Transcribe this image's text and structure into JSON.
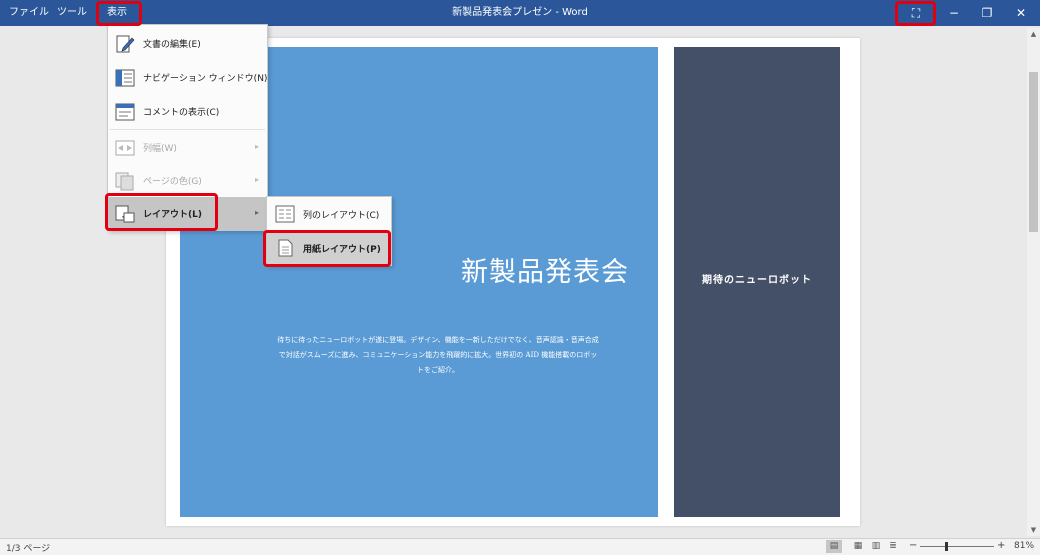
{
  "window": {
    "title": "新製品発表会プレゼン - Word",
    "menu": [
      "ファイル",
      "ツール",
      "表示"
    ],
    "controls": {
      "fullscreen": "⛶",
      "minimize": "−",
      "restore": "❐",
      "close": "✕"
    }
  },
  "view_menu": {
    "items": [
      {
        "label": "文書の編集(E)",
        "icon": "edit-document-icon",
        "enabled": true
      },
      {
        "label": "ナビゲーション ウィンドウ(N)",
        "icon": "navigation-pane-icon",
        "enabled": true
      },
      {
        "label": "コメントの表示(C)",
        "icon": "comment-icon",
        "enabled": true
      },
      {
        "label": "列幅(W)",
        "icon": "column-width-icon",
        "enabled": false,
        "submenu": true
      },
      {
        "label": "ページの色(G)",
        "icon": "page-color-icon",
        "enabled": false,
        "submenu": true
      },
      {
        "label": "レイアウト(L)",
        "icon": "layout-icon",
        "enabled": true,
        "submenu": true,
        "active": true
      }
    ]
  },
  "layout_submenu": {
    "items": [
      {
        "label": "列のレイアウト(C)",
        "icon": "column-layout-icon"
      },
      {
        "label": "用紙レイアウト(P)",
        "icon": "paper-layout-icon",
        "active": true
      }
    ]
  },
  "document": {
    "main_title": "新製品発表会",
    "body_lines": [
      "待ちに待ったニューロボットが遂に登場。デザイン、機能を一新しただけでなく、音声認識・音声合成",
      "で対話がスムーズに進み、コミュニケーション能力を飛躍的に拡大。世界初の AID 機能搭載のロボッ",
      "トをご紹介。"
    ],
    "side_title": "期待のニューロボット"
  },
  "status": {
    "page": "1/3 ページ",
    "zoom": "81%",
    "zoom_minus": "−",
    "zoom_plus": "+"
  },
  "colors": {
    "titlebar": "#2b579a",
    "slide_blue": "#5a9bd5",
    "slide_dark": "#435068",
    "highlight": "#e00010"
  }
}
